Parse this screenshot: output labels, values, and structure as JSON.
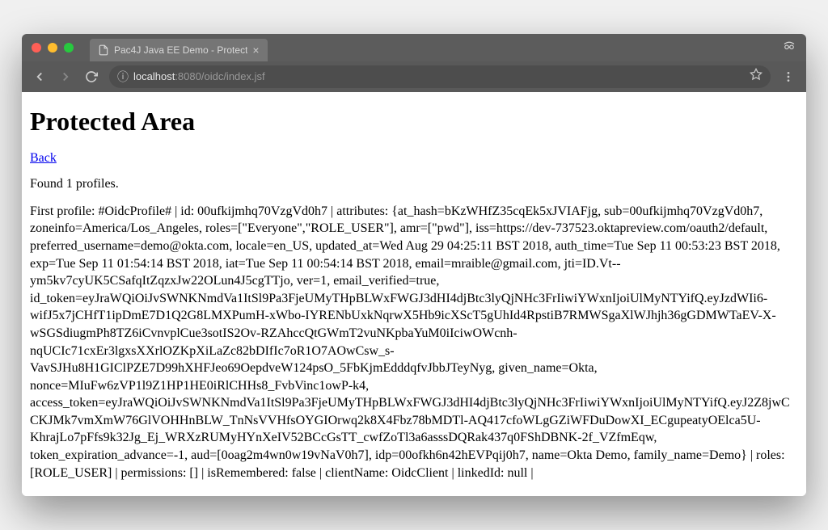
{
  "tab": {
    "title": "Pac4J Java EE Demo - Protect"
  },
  "address": {
    "host": "localhost",
    "port": ":8080",
    "path": "/oidc/index.jsf"
  },
  "page": {
    "heading": "Protected Area",
    "back_link": "Back",
    "profiles_found": "Found 1 profiles.",
    "profile_dump": "First profile: #OidcProfile# | id: 00ufkijmhq70VzgVd0h7 | attributes: {at_hash=bKzWHfZ35cqEk5xJVIAFjg, sub=00ufkijmhq70VzgVd0h7, zoneinfo=America/Los_Angeles, roles=[\"Everyone\",\"ROLE_USER\"], amr=[\"pwd\"], iss=https://dev-737523.oktapreview.com/oauth2/default, preferred_username=demo@okta.com, locale=en_US, updated_at=Wed Aug 29 04:25:11 BST 2018, auth_time=Tue Sep 11 00:53:23 BST 2018, exp=Tue Sep 11 01:54:14 BST 2018, iat=Tue Sep 11 00:54:14 BST 2018, email=mraible@gmail.com, jti=ID.Vt--ym5kv7cyUK5CSafqItZqzxJw22OLun4J5cgTTjo, ver=1, email_verified=true, id_token=eyJraWQiOiJvSWNKNmdVa1ItSl9Pa3FjeUMyTHpBLWxFWGJ3dHI4djBtc3lyQjNHc3FrIiwiYWxnIjoiUlMyNTYifQ.eyJzdWIi6-wifJ5x7jCHfT1ipDmE7D1Q2G8LMXPumH-xWbo-IYRENbUxkNqrwX5Hb9icXScT5gUhId4RpstiB7RMWSgaXlWJhjh36gGDMWTaEV-X-wSGSdiugmPh8TZ6iCvnvplCue3sotIS2Ov-RZAhccQtGWmT2vuNKpbaYuM0iIciwOWcnh-nqUCIc71cxEr3lgxsXXrlOZKpXiLaZc82bDIfIc7oR1O7AOwCsw_s-VavSJHu8H1GIClPZE7D99hXHFJeo69OepdveW124psO_5FbKjmEdddqfvJbbJTeyNyg, given_name=Okta, nonce=MIuFw6zVP1l9Z1HP1HE0iRlCHHs8_FvbVinc1owP-k4, access_token=eyJraWQiOiJvSWNKNmdVa1ItSl9Pa3FjeUMyTHpBLWxFWGJ3dHI4djBtc3lyQjNHc3FrIiwiYWxnIjoiUlMyNTYifQ.eyJ2Z8jwCCKJMk7vmXmW76GlVOHHnBLW_TnNsVVHfsOYGIOrwq2k8X4Fbz78bMDTl-AQ417cfoWLgGZiWFDuDowXI_ECgupeatyOElca5U-KhrajLo7pFfs9k32Jg_Ej_WRXzRUMyHYnXeIV52BCcGsTT_cwfZoTl3a6asssDQRak437q0FShDBNK-2f_VZfmEqw, token_expiration_advance=-1, aud=[0oag2m4wn0w19vNaV0h7], idp=00ofkh6n42hEVPqij0h7, name=Okta Demo, family_name=Demo} | roles: [ROLE_USER] | permissions: [] | isRemembered: false | clientName: OidcClient | linkedId: null |"
  }
}
